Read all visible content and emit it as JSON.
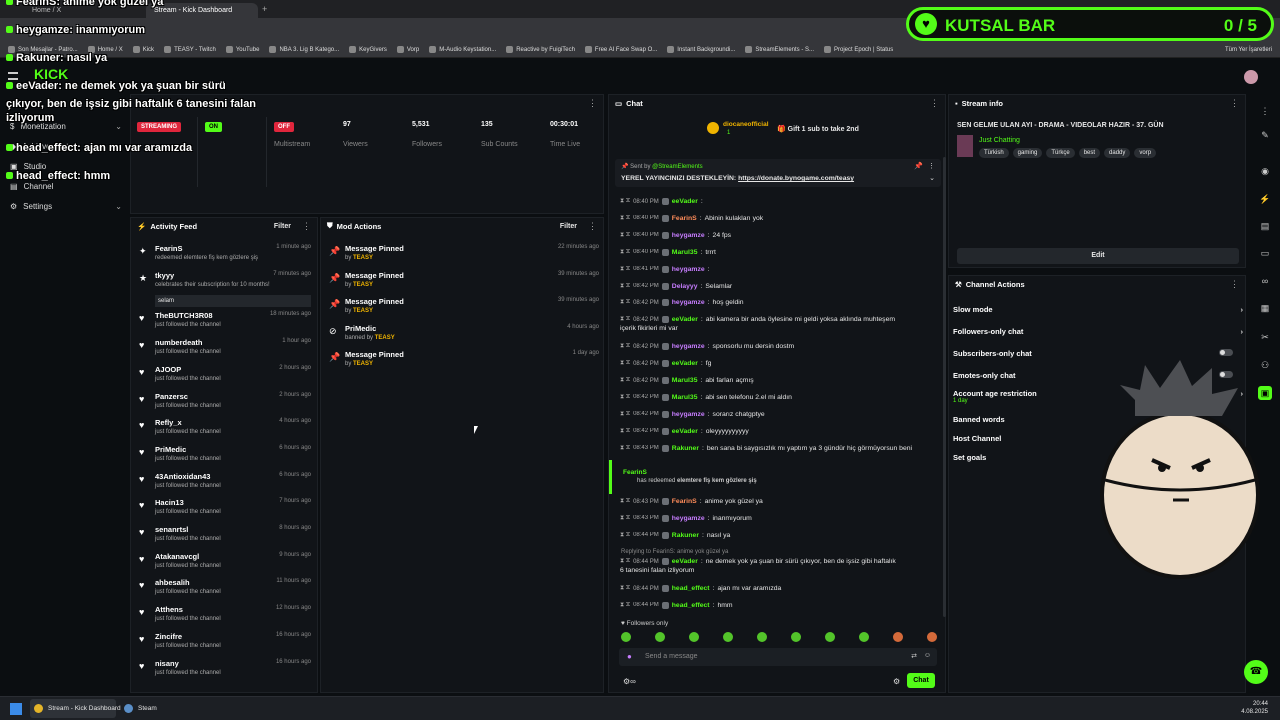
{
  "browser": {
    "tabs": [
      {
        "label": "Home / X"
      },
      {
        "label": "Stream - Kick Dashboard"
      }
    ],
    "bookmarks": [
      "Son Mesajlar - Patro...",
      "Home / X",
      "Kick",
      "TEASY - Twitch",
      "YouTube",
      "NBA 3. Lig B Katego...",
      "KeyGivers",
      "Vorp",
      "M-Audio Keystation...",
      "Reactive by FuigiTech",
      "Free AI Face Swap O...",
      "Instant Backgroundi...",
      "StreamElements - S...",
      "Project Epoch | Status"
    ],
    "all_bookmarks": "Tüm Yer İşaretleri"
  },
  "overlay": {
    "kutsal_bar": {
      "title": "KUTSAL BAR",
      "count": "0 / 5"
    },
    "chat": [
      {
        "name": "FearinS",
        "msg": ": anime yok güzel ya"
      },
      {
        "name": "heygamze",
        "msg": ": inanmıyorum"
      },
      {
        "name": "Rakuner",
        "msg": ": nasıl ya"
      },
      {
        "name": "eeVader",
        "msg": ": ne demek yok ya şuan bir sürü"
      },
      {
        "name": "",
        "msg": "çıkıyor, ben de işsiz gibi haftalık 6 tanesini falan"
      },
      {
        "name": "",
        "msg": "izliyorum"
      },
      {
        "name": "head_effect",
        "msg": ": ajan mı var aramızda"
      },
      {
        "name": "head_effect",
        "msg": ": hmm"
      }
    ]
  },
  "sidebar": {
    "items": [
      {
        "label": "Monetization"
      },
      {
        "label": "Achievements"
      },
      {
        "label": "Studio"
      },
      {
        "label": "Channel"
      },
      {
        "label": "Settings"
      }
    ]
  },
  "stream_stats": {
    "badges": [
      {
        "label": "STREAMING",
        "color": "#e0263c"
      },
      {
        "label": "ON",
        "color": "#53fc18"
      },
      {
        "label": "OFF",
        "color": "#e0263c"
      }
    ],
    "labels": [
      "Multistream"
    ],
    "stats": [
      {
        "value": "97",
        "label": "Viewers"
      },
      {
        "value": "5,531",
        "label": "Followers"
      },
      {
        "value": "135",
        "label": "Sub Counts"
      },
      {
        "value": "00:30:01",
        "label": "Time Live"
      }
    ]
  },
  "activity_feed": {
    "title": "Activity Feed",
    "filter": "Filter",
    "items": [
      {
        "name": "FearinS",
        "sub": "redeemed elemtere fiş kem gözlere şiş",
        "time": "1 minute ago",
        "icon": "gift-icon"
      },
      {
        "name": "tkyyy",
        "sub": "celebrates their subscription for 10 months!",
        "extra": "selam",
        "time": "7 minutes ago",
        "icon": "star-icon"
      },
      {
        "name": "TheBUTCH3R08",
        "sub": "just followed the channel",
        "time": "18 minutes ago",
        "icon": "heart-icon"
      },
      {
        "name": "numberdeath",
        "sub": "just followed the channel",
        "time": "1 hour ago",
        "icon": "heart-icon"
      },
      {
        "name": "AJOOP",
        "sub": "just followed the channel",
        "time": "2 hours ago",
        "icon": "heart-icon"
      },
      {
        "name": "Panzersc",
        "sub": "just followed the channel",
        "time": "2 hours ago",
        "icon": "heart-icon"
      },
      {
        "name": "Refly_x",
        "sub": "just followed the channel",
        "time": "4 hours ago",
        "icon": "heart-icon"
      },
      {
        "name": "PriMedic",
        "sub": "just followed the channel",
        "time": "6 hours ago",
        "icon": "heart-icon"
      },
      {
        "name": "43Antioxidan43",
        "sub": "just followed the channel",
        "time": "6 hours ago",
        "icon": "heart-icon"
      },
      {
        "name": "Hacin13",
        "sub": "just followed the channel",
        "time": "7 hours ago",
        "icon": "heart-icon"
      },
      {
        "name": "senanrtsl",
        "sub": "just followed the channel",
        "time": "8 hours ago",
        "icon": "heart-icon"
      },
      {
        "name": "Atakanavcgl",
        "sub": "just followed the channel",
        "time": "9 hours ago",
        "icon": "heart-icon"
      },
      {
        "name": "ahbesalih",
        "sub": "just followed the channel",
        "time": "11 hours ago",
        "icon": "heart-icon"
      },
      {
        "name": "Atthens",
        "sub": "just followed the channel",
        "time": "12 hours ago",
        "icon": "heart-icon"
      },
      {
        "name": "Zincifre",
        "sub": "just followed the channel",
        "time": "16 hours ago",
        "icon": "heart-icon"
      },
      {
        "name": "nisany",
        "sub": "just followed the channel",
        "time": "16 hours ago",
        "icon": "heart-icon"
      }
    ]
  },
  "mod_actions": {
    "title": "Mod Actions",
    "filter": "Filter",
    "items": [
      {
        "title": "Message Pinned",
        "by": "by",
        "who": "TEASY",
        "time": "22 minutes ago",
        "icon": "pin-icon"
      },
      {
        "title": "Message Pinned",
        "by": "by",
        "who": "TEASY",
        "time": "39 minutes ago",
        "icon": "pin-icon"
      },
      {
        "title": "Message Pinned",
        "by": "by",
        "who": "TEASY",
        "time": "39 minutes ago",
        "icon": "pin-icon"
      },
      {
        "title": "PriMedic",
        "by": "banned by",
        "who": "TEASY",
        "time": "4 hours ago",
        "icon": "ban-icon"
      },
      {
        "title": "Message Pinned",
        "by": "by",
        "who": "TEASY",
        "time": "1 day ago",
        "icon": "pin-icon"
      }
    ]
  },
  "chat": {
    "title": "Chat",
    "top_gifter": {
      "name": "diocaneofficial",
      "count": "1",
      "gift_text": "Gift 1 sub to take 2nd"
    },
    "pinned": {
      "sent_by": "Sent by",
      "sender": "@StreamElements",
      "text": "YEREL YAYINCINIZI DESTEKLEYİN: ",
      "link": "https://donate.bynogame.com/teasy"
    },
    "messages": [
      {
        "time": "08:40 PM",
        "name": "eeVader",
        "color": "#53fc18",
        "msg": ""
      },
      {
        "time": "08:40 PM",
        "name": "FearinS",
        "color": "#ff8c5a",
        "msg": " Abinin kulakları yok"
      },
      {
        "time": "08:40 PM",
        "name": "heygamze",
        "color": "#c77dff",
        "msg": " 24 fps"
      },
      {
        "time": "08:40 PM",
        "name": "Marul35",
        "color": "#53fc18",
        "msg": " trrrt"
      },
      {
        "time": "08:41 PM",
        "name": "heygamze",
        "color": "#c77dff",
        "msg": ""
      },
      {
        "time": "08:42 PM",
        "name": "Delayyy",
        "color": "#c77dff",
        "msg": " Selamlar"
      },
      {
        "time": "08:42 PM",
        "name": "heygamze",
        "color": "#c77dff",
        "msg": " hoş geldin"
      },
      {
        "time": "08:42 PM",
        "name": "eeVader",
        "color": "#53fc18",
        "msg": " abi kamera bir anda öylesine mi geldi yoksa aklında muhteşem"
      },
      {
        "time": "",
        "name": "",
        "color": "#e6e6e6",
        "msg": "içerik fikirleri mi var"
      },
      {
        "time": "08:42 PM",
        "name": "heygamze",
        "color": "#c77dff",
        "msg": " sponsorlu mu dersin dostm"
      },
      {
        "time": "08:42 PM",
        "name": "eeVader",
        "color": "#53fc18",
        "msg": " fg"
      },
      {
        "time": "08:42 PM",
        "name": "Marul35",
        "color": "#53fc18",
        "msg": " abi farları açmış"
      },
      {
        "time": "08:42 PM",
        "name": "Marul35",
        "color": "#53fc18",
        "msg": " abi sen telefonu 2.el mi aldın"
      },
      {
        "time": "08:42 PM",
        "name": "heygamze",
        "color": "#c77dff",
        "msg": " sorarız chatgptye"
      },
      {
        "time": "08:42 PM",
        "name": "eeVader",
        "color": "#53fc18",
        "msg": " oleyyyyyyyyyy"
      },
      {
        "time": "08:43 PM",
        "name": "Rakuner",
        "color": "#53fc18",
        "msg": " ben sana bi saygısızlık mı yaptım ya 3 gündür hiç görmüyorsun beni"
      }
    ],
    "redeem": {
      "name": "FearinS",
      "text": "has redeemed",
      "reward": "elemtere fiş kem gözlere şiş"
    },
    "messages2": [
      {
        "time": "08:43 PM",
        "name": "FearinS",
        "color": "#ff8c5a",
        "msg": " anime yok güzel ya"
      },
      {
        "time": "08:43 PM",
        "name": "heygamze",
        "color": "#c77dff",
        "msg": " inanmıyorum"
      },
      {
        "time": "08:44 PM",
        "name": "Rakuner",
        "color": "#53fc18",
        "msg": " nasıl ya"
      }
    ],
    "reply_to": "Replying to FearinS: anime yok güzel ya",
    "reply_msg": {
      "time": "08:44 PM",
      "name": "eeVader",
      "color": "#53fc18",
      "msg": " ne demek yok ya şuan bir sürü çıkıyor, ben de işsiz gibi haftalık"
    },
    "reply_msg2": "6 tanesini falan izliyorum",
    "messages3": [
      {
        "time": "08:44 PM",
        "name": "head_effect",
        "color": "#53fc18",
        "msg": " ajan mı var aramızda"
      },
      {
        "time": "08:44 PM",
        "name": "head_effect",
        "color": "#53fc18",
        "msg": " hmm"
      }
    ],
    "followers_only": "Followers only",
    "input_placeholder": "Send a message",
    "send_label": "Chat"
  },
  "stream_info": {
    "title": "Stream info",
    "stream_title": "SEN GELME ULAN AYI - DRAMA - VIDEOLAR HAZIR - 37. GÜN",
    "category": "Just Chatting",
    "tags": [
      "Türkish",
      "gaming",
      "Türkçe",
      "best",
      "daddy",
      "vorp"
    ],
    "edit_label": "Edit"
  },
  "channel_actions": {
    "title": "Channel Actions",
    "items": [
      {
        "label": "Slow mode",
        "type": "chevron"
      },
      {
        "label": "Followers-only chat",
        "type": "chevron"
      },
      {
        "label": "Subscribers-only chat",
        "type": "toggle"
      },
      {
        "label": "Emotes-only chat",
        "type": "toggle"
      },
      {
        "label": "Account age restriction",
        "sub": "1 day",
        "type": "chevron"
      },
      {
        "label": "Banned words",
        "type": "none"
      },
      {
        "label": "Host Channel",
        "type": "none"
      },
      {
        "label": "Set goals",
        "type": "none"
      }
    ]
  },
  "taskbar": {
    "items": [
      "Stream - Kick Dashboard",
      "Steam"
    ],
    "time": "20:44",
    "date": "4.08.2025"
  },
  "colors": {
    "accent": "#53fc18",
    "panel": "#111418",
    "bg": "#0b0e11"
  }
}
